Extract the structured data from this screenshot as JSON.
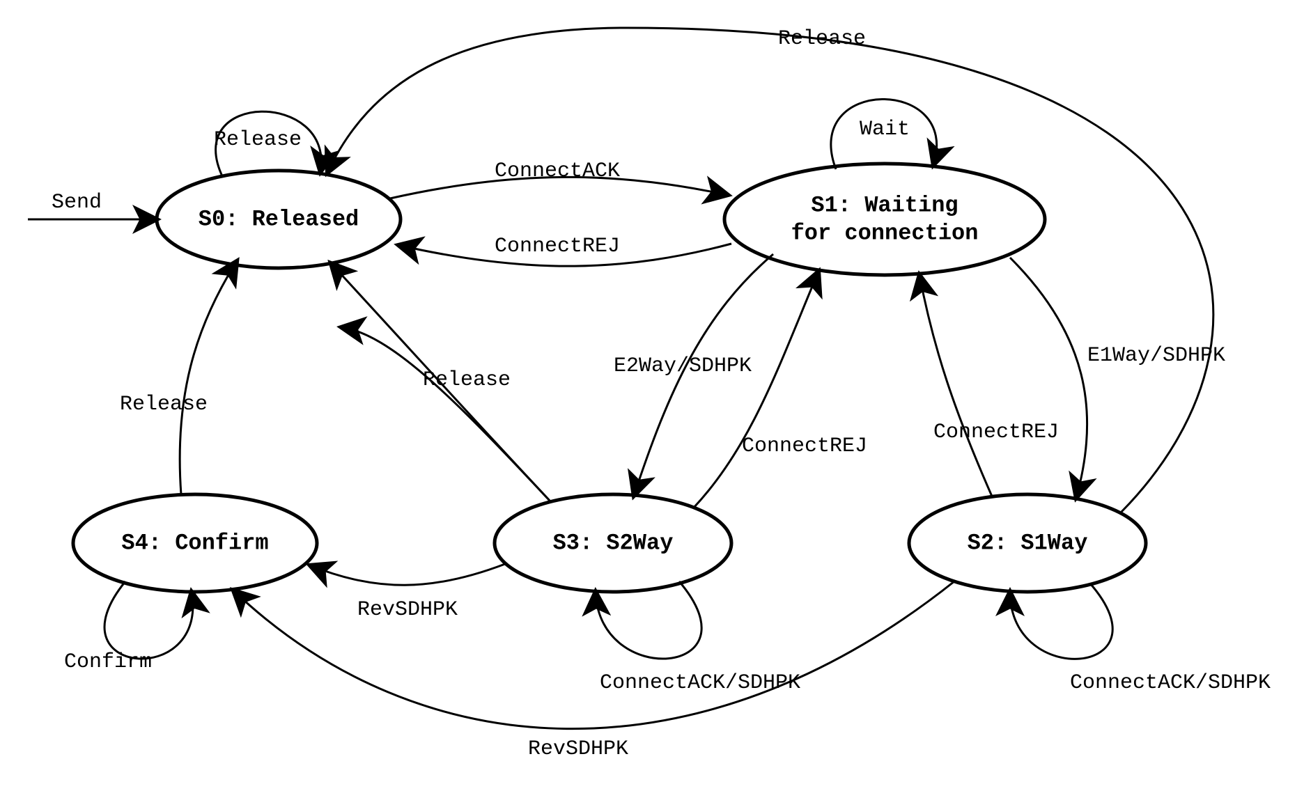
{
  "states": {
    "s0": {
      "line1": "S0: Released"
    },
    "s1": {
      "line1": "S1: Waiting",
      "line2": "for connection"
    },
    "s2": {
      "line1": "S2: S1Way"
    },
    "s3": {
      "line1": "S3: S2Way"
    },
    "s4": {
      "line1": "S4: Confirm"
    }
  },
  "edges": {
    "send": "Send",
    "s0_self": "Release",
    "s0_s1": "ConnectACK",
    "s1_s0": "ConnectREJ",
    "s1_self": "Wait",
    "s1_s2": "E1Way/SDHPK",
    "s2_s1": "ConnectREJ",
    "s1_s3": "E2Way/SDHPK",
    "s3_s1": "ConnectREJ",
    "s2_self": "ConnectACK/SDHPK",
    "s3_self": "ConnectACK/SDHPK",
    "s2_s4": "RevSDHPK",
    "s3_s4": "RevSDHPK",
    "s4_self": "Confirm",
    "s4_s0": "Release",
    "s3_s0": "Release",
    "s2_s0_top": "Release"
  }
}
